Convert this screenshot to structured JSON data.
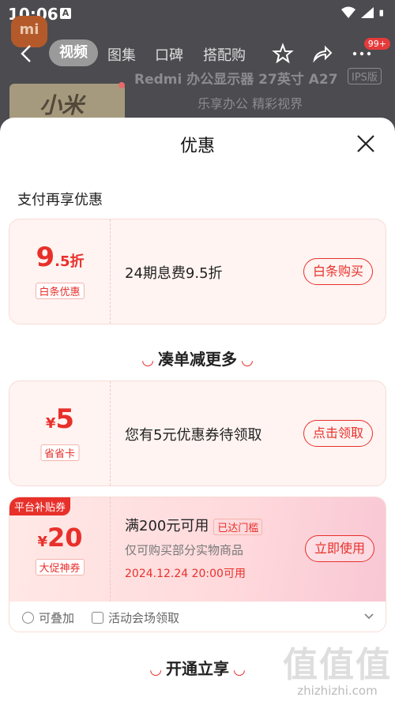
{
  "status_bar": {
    "time": "10:06",
    "notif_letter": "A"
  },
  "background": {
    "logo_text": "mi",
    "tabs": [
      "视频",
      "图集",
      "口碑",
      "搭配购"
    ],
    "badge": "99+",
    "product_title": "Redmi 办公显示器 27英寸 A27",
    "product_badge": "IPS版",
    "slogan": "乐享办公 精彩视界",
    "thumb_text": "小米"
  },
  "sheet": {
    "title": "优惠",
    "section_pay": "支付再享优惠",
    "cards": [
      {
        "amount_main": "9",
        "amount_sub": ".5折",
        "tag": "白条优惠",
        "text": "24期息费9.5折",
        "button": "白条购买"
      },
      {
        "currency": "¥",
        "amount_main": "5",
        "tag": "省省卡",
        "text": "您有5元优惠券待领取",
        "button": "点击领取"
      }
    ],
    "divider_more": "凑单减更多",
    "platform": {
      "ribbon": "平台补贴券",
      "currency": "¥",
      "amount": "20",
      "tag": "大促神券",
      "title": "满200元可用",
      "threshold": "已达门槛",
      "desc": "仅可购买部分实物商品",
      "expiry": "2024.12.24 20:00可用",
      "button": "立即使用",
      "foot_stack": "可叠加",
      "foot_source": "活动会场领取"
    },
    "divider_open": "开通立享"
  },
  "watermark": {
    "big": "值值值",
    "small": "zhizhizhi.com"
  },
  "colors": {
    "accent": "#e8302b",
    "card_bg": "#fff4f2"
  }
}
